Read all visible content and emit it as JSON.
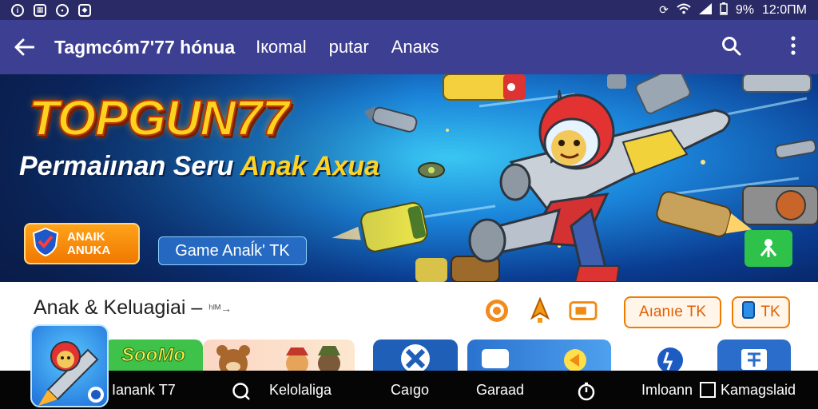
{
  "status_bar": {
    "icons": [
      "info-icon",
      "gallery-icon",
      "message-icon",
      "game-icon"
    ],
    "battery": "9%",
    "time": "12:0ΠM"
  },
  "app_bar": {
    "title": "Tagmcóm7'77 hónua",
    "tabs": [
      "Iкomal",
      "putar",
      "Anaкs"
    ],
    "icons": [
      "back-arrow-icon",
      "search-icon",
      "more-vert-icon"
    ]
  },
  "banner": {
    "brand": "TOPGUN77",
    "subtitle_pre": "Permaiınan Seru ",
    "subtitle_mid": "Anak ",
    "subtitle_end": "Aхua",
    "badge_label": "ANAIK ANUKA",
    "chip_label": "Game Anaĺk' TK",
    "colors": {
      "brand": "#ffd21f",
      "sky": "#1b84d9"
    }
  },
  "section": {
    "title": "Anak & Keluagiai –",
    "more": "ʰᴵᴹ→",
    "pill_1": "Aıanıe TK",
    "pill_2": "TK",
    "cards": [
      "SooMo"
    ]
  },
  "bottom_bar": {
    "items": [
      "Ianank T7",
      "Kelolaliga",
      "Caıgo",
      "Garaad",
      "Imloann",
      "Kamagslaid"
    ]
  },
  "colors": {
    "app_bar": "#3d3f92",
    "status_bar": "#2a2a66",
    "accent": "#f07b00"
  }
}
